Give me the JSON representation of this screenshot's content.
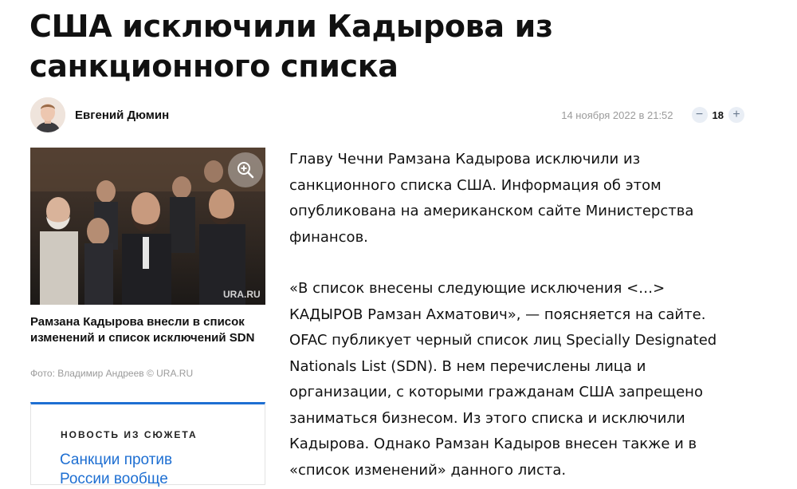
{
  "article": {
    "title": "США исключили Кадырова из санкционного списка"
  },
  "author": {
    "name": "Евгений Дюмин",
    "avatar_icon": "author-portrait-icon"
  },
  "meta": {
    "date": "14 ноября 2022 в 21:52",
    "comments_count": "18",
    "minus_label": "−",
    "plus_label": "+"
  },
  "photo": {
    "zoom_icon": "zoom-in-icon",
    "watermark": "URA.RU",
    "caption": "Рамзана Кадырова внесли в список изменений и список исключений SDN",
    "credit": "Фото: Владимир Андреев © URA.RU"
  },
  "story": {
    "label": "НОВОСТЬ ИЗ СЮЖЕТА",
    "link": "Санкции против России вообще"
  },
  "body": {
    "paragraphs": [
      "Главу Чечни Рамзана Кадырова исключили из санкционного списка США. Информация об этом опубликована на американском сайте Министерства финансов.",
      "«В список внесены следующие исключения <…> КАДЫРОВ Рамзан Ахматович», — поясняется на сайте. OFAC публикует черный список лиц Specially Designated Nationals List (SDN). В нем перечислены лица и организации, с которыми гражданам США запрещено заниматься бизнесом. Из этого списка и исключили Кадырова. Однако Рамзан Кадыров внесен также и в «список изменений» данного листа."
    ]
  },
  "colors": {
    "accent": "#1e6fd2",
    "muted": "#9b9b9b",
    "text": "#111111"
  }
}
